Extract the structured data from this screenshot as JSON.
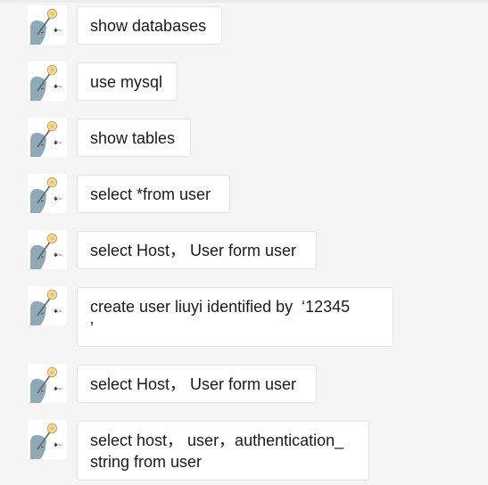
{
  "chat": {
    "messages": [
      {
        "avatar_icon": "user-avatar-icon",
        "text": "show databases"
      },
      {
        "avatar_icon": "user-avatar-icon",
        "text": "use mysql"
      },
      {
        "avatar_icon": "user-avatar-icon",
        "text": "show tables"
      },
      {
        "avatar_icon": "user-avatar-icon",
        "text": "select *from user"
      },
      {
        "avatar_icon": "user-avatar-icon",
        "text": "select Host， User form user"
      },
      {
        "avatar_icon": "user-avatar-icon",
        "text": "create user liuyi identified by  ‘12345\n’"
      },
      {
        "avatar_icon": "user-avatar-icon",
        "text": "select Host， User form user"
      },
      {
        "avatar_icon": "user-avatar-icon",
        "text": "select host， user，authentication_\nstring from user"
      }
    ]
  },
  "colors": {
    "background": "#f5f5f5",
    "bubble": "#ffffff",
    "bubble_border": "#e3e3e3",
    "text": "#1a1a1a",
    "avatar_shape": "#8fa9b6"
  }
}
